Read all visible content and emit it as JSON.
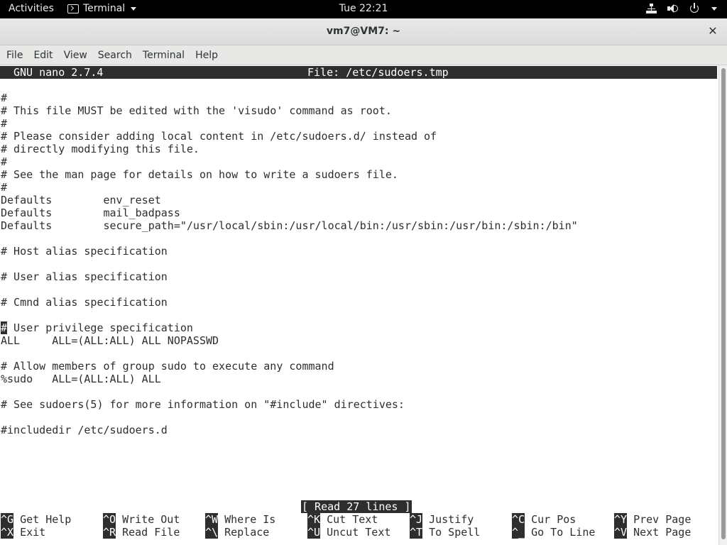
{
  "topbar": {
    "activities": "Activities",
    "app_menu": "Terminal",
    "clock": "Tue 22:21"
  },
  "window": {
    "title": "vm7@VM7: ~",
    "close": "✕"
  },
  "menubar": {
    "items": [
      "File",
      "Edit",
      "View",
      "Search",
      "Terminal",
      "Help"
    ]
  },
  "nano": {
    "version": "GNU nano 2.7.4",
    "file_label": "File: /etc/sudoers.tmp",
    "status": "[ Read 27 lines ]",
    "lines": [
      "#",
      "# This file MUST be edited with the 'visudo' command as root.",
      "#",
      "# Please consider adding local content in /etc/sudoers.d/ instead of",
      "# directly modifying this file.",
      "#",
      "# See the man page for details on how to write a sudoers file.",
      "#",
      "Defaults        env_reset",
      "Defaults        mail_badpass",
      "Defaults        secure_path=\"/usr/local/sbin:/usr/local/bin:/usr/sbin:/usr/bin:/sbin:/bin\"",
      "",
      "# Host alias specification",
      "",
      "# User alias specification",
      "",
      "# Cmnd alias specification",
      "",
      "# User privilege specification",
      "ALL     ALL=(ALL:ALL) ALL NOPASSWD",
      "",
      "# Allow members of group sudo to execute any command",
      "%sudo   ALL=(ALL:ALL) ALL",
      "",
      "# See sudoers(5) for more information on \"#include\" directives:",
      "",
      "#includedir /etc/sudoers.d"
    ],
    "cursor_line": 18,
    "shortcuts_row1": [
      {
        "key": "^G",
        "label": "Get Help"
      },
      {
        "key": "^O",
        "label": "Write Out"
      },
      {
        "key": "^W",
        "label": "Where Is"
      },
      {
        "key": "^K",
        "label": "Cut Text"
      },
      {
        "key": "^J",
        "label": "Justify"
      },
      {
        "key": "^C",
        "label": "Cur Pos"
      },
      {
        "key": "^Y",
        "label": "Prev Page"
      }
    ],
    "shortcuts_row2": [
      {
        "key": "^X",
        "label": "Exit"
      },
      {
        "key": "^R",
        "label": "Read File"
      },
      {
        "key": "^\\",
        "label": "Replace"
      },
      {
        "key": "^U",
        "label": "Uncut Text"
      },
      {
        "key": "^T",
        "label": "To Spell"
      },
      {
        "key": "^_",
        "label": "Go To Line"
      },
      {
        "key": "^V",
        "label": "Next Page"
      }
    ]
  }
}
